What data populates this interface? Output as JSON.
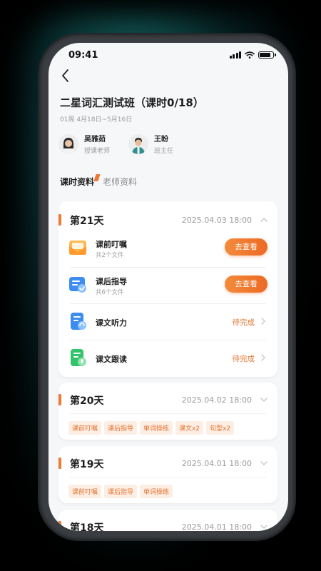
{
  "status": {
    "time": "09:41"
  },
  "course": {
    "title": "二星词汇测试班（课时0/18）",
    "meta": "01周  4月18日~5月16日"
  },
  "teachers": [
    {
      "name": "吴雅茹",
      "role": "授课老师"
    },
    {
      "name": "王盼",
      "role": "班主任"
    }
  ],
  "tabs": [
    {
      "label": "课时资料"
    },
    {
      "label": "老师资料"
    }
  ],
  "days": [
    {
      "title": "第21天",
      "date": "2025.04.03 18:00",
      "items": [
        {
          "title": "课前叮嘱",
          "sub": "共2个文件",
          "action": "去查看",
          "icon": "envelope-icon"
        },
        {
          "title": "课后指导",
          "sub": "共6个文件",
          "action": "去查看",
          "icon": "document-check-icon"
        },
        {
          "title": "课文听力",
          "status": "待完成",
          "icon": "headphone-doc-icon"
        },
        {
          "title": "课文跟读",
          "status": "待完成",
          "icon": "read-aloud-icon"
        }
      ]
    },
    {
      "title": "第20天",
      "date": "2025.04.02 18:00",
      "tags": [
        "课前叮嘱",
        "课后指导",
        "单词操练",
        "课文x2",
        "句型x2"
      ]
    },
    {
      "title": "第19天",
      "date": "2025.04.01 18:00",
      "tags": [
        "课前叮嘱",
        "课后指导",
        "单词操练"
      ]
    },
    {
      "title": "第18天",
      "date": "2025.04.01 18:00"
    }
  ],
  "colors": {
    "accent": "#f07a32",
    "accent_button": "#ec6a25",
    "background": "#f6f7f9"
  }
}
